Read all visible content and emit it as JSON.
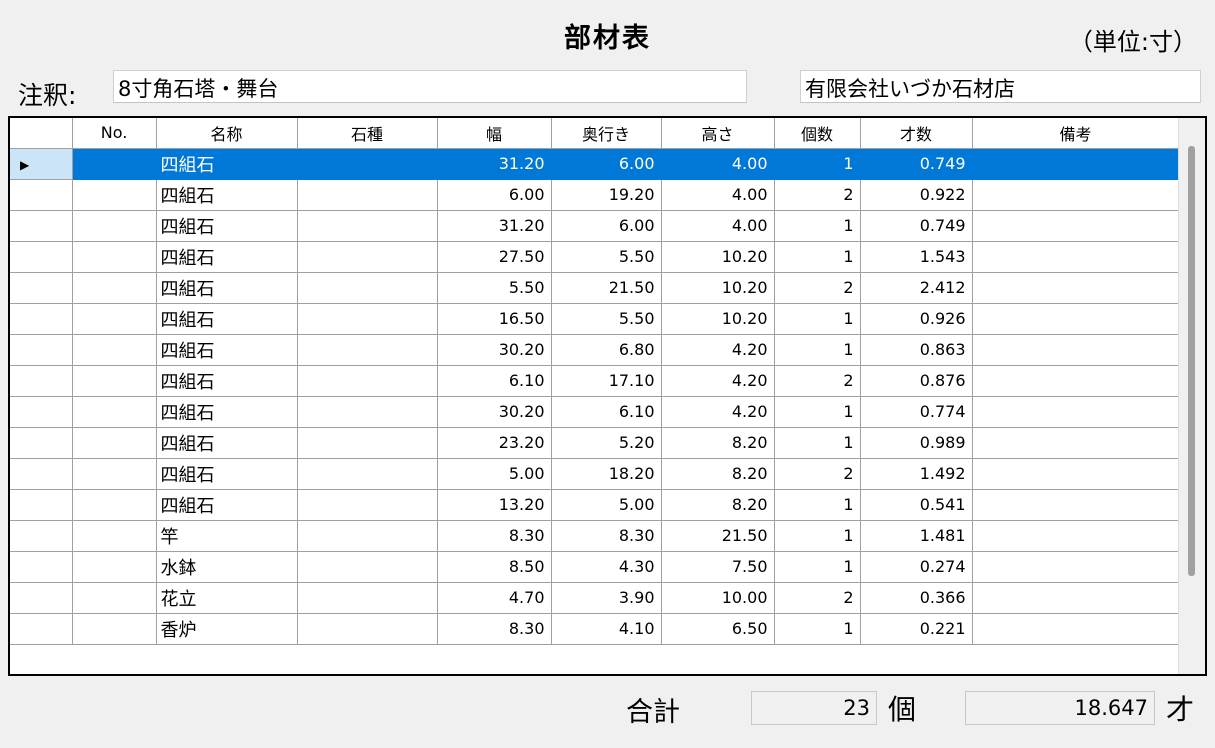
{
  "header": {
    "title": "部材表",
    "unit": "（単位:寸）"
  },
  "note": {
    "label": "注釈:",
    "value": "8寸角石塔・舞台",
    "company": "有限会社いづか石材店"
  },
  "table": {
    "columns": [
      "No.",
      "名称",
      "石種",
      "幅",
      "奥行き",
      "高さ",
      "個数",
      "才数",
      "備考"
    ],
    "selected_row": 0,
    "rows": [
      {
        "no": "",
        "name": "四組石",
        "stone": "",
        "width": "31.20",
        "depth": "6.00",
        "height": "4.00",
        "count": "1",
        "sai": "0.749",
        "remarks": ""
      },
      {
        "no": "",
        "name": "四組石",
        "stone": "",
        "width": "6.00",
        "depth": "19.20",
        "height": "4.00",
        "count": "2",
        "sai": "0.922",
        "remarks": ""
      },
      {
        "no": "",
        "name": "四組石",
        "stone": "",
        "width": "31.20",
        "depth": "6.00",
        "height": "4.00",
        "count": "1",
        "sai": "0.749",
        "remarks": ""
      },
      {
        "no": "",
        "name": "四組石",
        "stone": "",
        "width": "27.50",
        "depth": "5.50",
        "height": "10.20",
        "count": "1",
        "sai": "1.543",
        "remarks": ""
      },
      {
        "no": "",
        "name": "四組石",
        "stone": "",
        "width": "5.50",
        "depth": "21.50",
        "height": "10.20",
        "count": "2",
        "sai": "2.412",
        "remarks": ""
      },
      {
        "no": "",
        "name": "四組石",
        "stone": "",
        "width": "16.50",
        "depth": "5.50",
        "height": "10.20",
        "count": "1",
        "sai": "0.926",
        "remarks": ""
      },
      {
        "no": "",
        "name": "四組石",
        "stone": "",
        "width": "30.20",
        "depth": "6.80",
        "height": "4.20",
        "count": "1",
        "sai": "0.863",
        "remarks": ""
      },
      {
        "no": "",
        "name": "四組石",
        "stone": "",
        "width": "6.10",
        "depth": "17.10",
        "height": "4.20",
        "count": "2",
        "sai": "0.876",
        "remarks": ""
      },
      {
        "no": "",
        "name": "四組石",
        "stone": "",
        "width": "30.20",
        "depth": "6.10",
        "height": "4.20",
        "count": "1",
        "sai": "0.774",
        "remarks": ""
      },
      {
        "no": "",
        "name": "四組石",
        "stone": "",
        "width": "23.20",
        "depth": "5.20",
        "height": "8.20",
        "count": "1",
        "sai": "0.989",
        "remarks": ""
      },
      {
        "no": "",
        "name": "四組石",
        "stone": "",
        "width": "5.00",
        "depth": "18.20",
        "height": "8.20",
        "count": "2",
        "sai": "1.492",
        "remarks": ""
      },
      {
        "no": "",
        "name": "四組石",
        "stone": "",
        "width": "13.20",
        "depth": "5.00",
        "height": "8.20",
        "count": "1",
        "sai": "0.541",
        "remarks": ""
      },
      {
        "no": "",
        "name": "竿",
        "stone": "",
        "width": "8.30",
        "depth": "8.30",
        "height": "21.50",
        "count": "1",
        "sai": "1.481",
        "remarks": ""
      },
      {
        "no": "",
        "name": "水鉢",
        "stone": "",
        "width": "8.50",
        "depth": "4.30",
        "height": "7.50",
        "count": "1",
        "sai": "0.274",
        "remarks": ""
      },
      {
        "no": "",
        "name": "花立",
        "stone": "",
        "width": "4.70",
        "depth": "3.90",
        "height": "10.00",
        "count": "2",
        "sai": "0.366",
        "remarks": ""
      },
      {
        "no": "",
        "name": "香炉",
        "stone": "",
        "width": "8.30",
        "depth": "4.10",
        "height": "6.50",
        "count": "1",
        "sai": "0.221",
        "remarks": ""
      }
    ]
  },
  "totals": {
    "label": "合計",
    "count": "23",
    "count_unit": "個",
    "sai": "18.647",
    "sai_unit": "才"
  },
  "colors": {
    "selection": "#0078d7",
    "row_header_selected": "#cce4f7"
  }
}
